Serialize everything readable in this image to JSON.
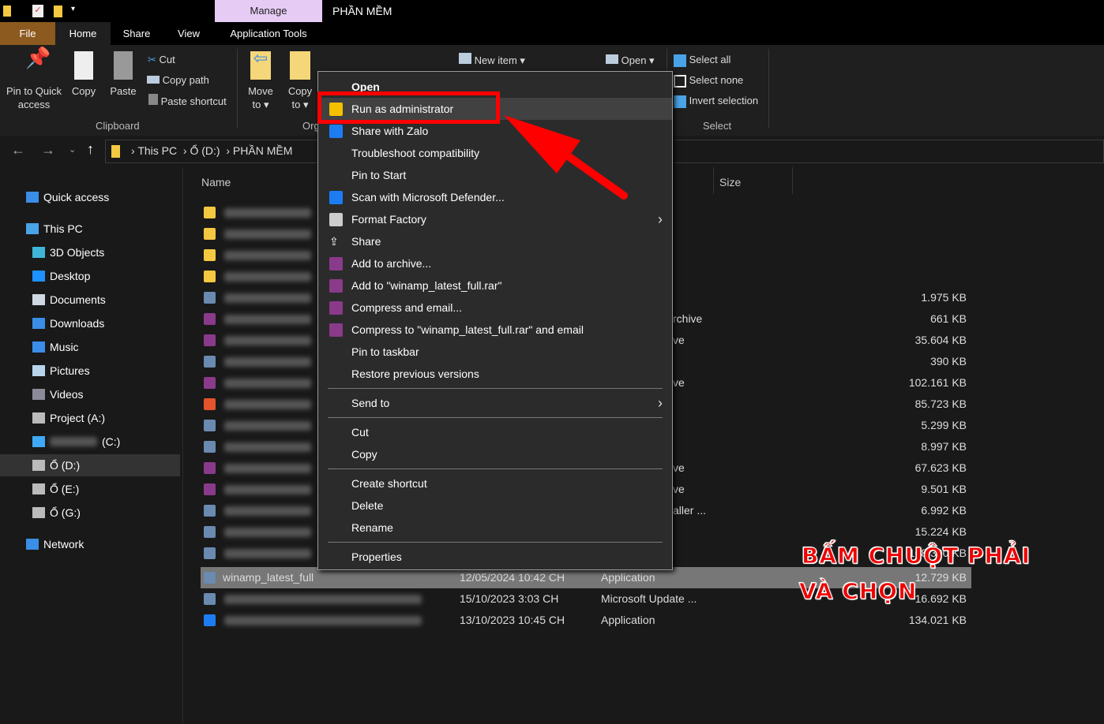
{
  "window": {
    "title": "PHẦN MỀM",
    "context_tab": "Manage"
  },
  "tabs": [
    "File",
    "Home",
    "Share",
    "View",
    "Application Tools"
  ],
  "ribbon": {
    "pin": "Pin to Quick access",
    "copy": "Copy",
    "paste": "Paste",
    "cut": "Cut",
    "copy_path": "Copy path",
    "paste_shortcut": "Paste shortcut",
    "clipboard": "Clipboard",
    "move_to": "Move to",
    "copy_to": "Copy to",
    "organize": "Org",
    "new_item": "New item",
    "open": "Open",
    "select_all": "Select all",
    "select_none": "Select none",
    "invert_selection": "Invert selection",
    "select": "Select"
  },
  "breadcrumb": [
    "This PC",
    "Ổ (D:)",
    "PHẦN MỀM"
  ],
  "nav": [
    {
      "label": "Quick access",
      "icon": "star-icon",
      "color": "#3a8ee6"
    },
    {
      "label": "This PC",
      "icon": "computer-icon",
      "color": "#4aa3e6"
    },
    {
      "label": "3D Objects",
      "icon": "cube-icon",
      "color": "#3fb6d8"
    },
    {
      "label": "Desktop",
      "icon": "desktop-icon",
      "color": "#1e90ff"
    },
    {
      "label": "Documents",
      "icon": "document-icon",
      "color": "#cfd8e0"
    },
    {
      "label": "Downloads",
      "icon": "download-icon",
      "color": "#3a8ee6"
    },
    {
      "label": "Music",
      "icon": "music-icon",
      "color": "#3a8ee6"
    },
    {
      "label": "Pictures",
      "icon": "pictures-icon",
      "color": "#b8d4ea"
    },
    {
      "label": "Videos",
      "icon": "videos-icon",
      "color": "#8a8a9a"
    },
    {
      "label": "Project (A:)",
      "icon": "drive-icon",
      "color": "#bbb"
    },
    {
      "label": "(C:)",
      "icon": "windows-drive-icon",
      "color": "#3fa9f5"
    },
    {
      "label": "Ổ (D:)",
      "icon": "drive-icon",
      "color": "#bbb"
    },
    {
      "label": "Ổ (E:)",
      "icon": "drive-icon",
      "color": "#bbb"
    },
    {
      "label": "Ổ (G:)",
      "icon": "drive-icon",
      "color": "#bbb"
    },
    {
      "label": "Network",
      "icon": "network-icon",
      "color": "#3a8ee6"
    }
  ],
  "columns": {
    "name": "Name",
    "size": "Size"
  },
  "files": [
    {
      "name": "",
      "date": "",
      "type": "",
      "size": "",
      "icon": "folder-icon"
    },
    {
      "name": "",
      "date": "",
      "type": "",
      "size": "",
      "icon": "folder-icon"
    },
    {
      "name": "",
      "date": "",
      "type": "",
      "size": "",
      "icon": "folder-icon"
    },
    {
      "name": "",
      "date": "",
      "type": "",
      "size": "",
      "icon": "folder-icon"
    },
    {
      "name": "",
      "date": "",
      "type": "",
      "size": "1.975 KB",
      "icon": "installer-icon"
    },
    {
      "name": "",
      "date": "",
      "type": "rchive",
      "size": "661 KB",
      "icon": "winrar-icon"
    },
    {
      "name": "",
      "date": "",
      "type": "ve",
      "size": "35.604 KB",
      "icon": "winrar-icon"
    },
    {
      "name": "",
      "date": "",
      "type": "",
      "size": "390 KB",
      "icon": "app-icon"
    },
    {
      "name": "",
      "date": "",
      "type": "ve",
      "size": "102.161 KB",
      "icon": "winrar-icon"
    },
    {
      "name": "",
      "date": "",
      "type": "",
      "size": "85.723 KB",
      "icon": "office-icon"
    },
    {
      "name": "",
      "date": "",
      "type": "",
      "size": "5.299 KB",
      "icon": "app-icon"
    },
    {
      "name": "",
      "date": "",
      "type": "",
      "size": "8.997 KB",
      "icon": "app-icon"
    },
    {
      "name": "",
      "date": "",
      "type": "ve",
      "size": "67.623 KB",
      "icon": "winrar-icon"
    },
    {
      "name": "",
      "date": "",
      "type": "ve",
      "size": "9.501 KB",
      "icon": "winrar-icon"
    },
    {
      "name": "",
      "date": "",
      "type": "aller ...",
      "size": "6.992 KB",
      "icon": "installer-icon"
    },
    {
      "name": "",
      "date": "",
      "type": "",
      "size": "15.224 KB",
      "icon": "installer-icon"
    },
    {
      "name": "",
      "date": "",
      "type": "",
      "size": "108.300 KB",
      "icon": "package-icon"
    },
    {
      "name": "winamp_latest_full",
      "date": "12/05/2024 10:42 CH",
      "type": "Application",
      "size": "12.729 KB",
      "icon": "winamp-icon",
      "selected": true
    },
    {
      "name": "",
      "date": "15/10/2023 3:03 CH",
      "type": "Microsoft Update ...",
      "size": "16.692 KB",
      "icon": "update-icon"
    },
    {
      "name": "",
      "date": "13/10/2023 10:45 CH",
      "type": "Application",
      "size": "134.021 KB",
      "icon": "zalo-icon"
    }
  ],
  "context_menu": {
    "groups": [
      [
        {
          "label": "Open",
          "bold": true
        },
        {
          "label": "Run as administrator",
          "icon": "shield-icon",
          "highlight": true
        },
        {
          "label": "Share with Zalo",
          "icon": "zalo-icon"
        },
        {
          "label": "Troubleshoot compatibility"
        },
        {
          "label": "Pin to Start"
        },
        {
          "label": "Scan with Microsoft Defender...",
          "icon": "defender-icon"
        },
        {
          "label": "Format Factory",
          "icon": "format-factory-icon",
          "submenu": true
        },
        {
          "label": "Share",
          "icon": "share-icon"
        },
        {
          "label": "Add to archive...",
          "icon": "winrar-icon"
        },
        {
          "label": "Add to \"winamp_latest_full.rar\"",
          "icon": "winrar-icon"
        },
        {
          "label": "Compress and email...",
          "icon": "winrar-icon"
        },
        {
          "label": "Compress to \"winamp_latest_full.rar\" and email",
          "icon": "winrar-icon"
        },
        {
          "label": "Pin to taskbar"
        },
        {
          "label": "Restore previous versions"
        }
      ],
      [
        {
          "label": "Send to",
          "submenu": true
        }
      ],
      [
        {
          "label": "Cut"
        },
        {
          "label": "Copy"
        }
      ],
      [
        {
          "label": "Create shortcut"
        },
        {
          "label": "Delete"
        },
        {
          "label": "Rename"
        }
      ],
      [
        {
          "label": "Properties"
        }
      ]
    ]
  },
  "annotation": {
    "line1": "BẤM CHUỘT PHẢI",
    "line2": "VÀ CHỌN",
    "color": "#ff0000"
  }
}
